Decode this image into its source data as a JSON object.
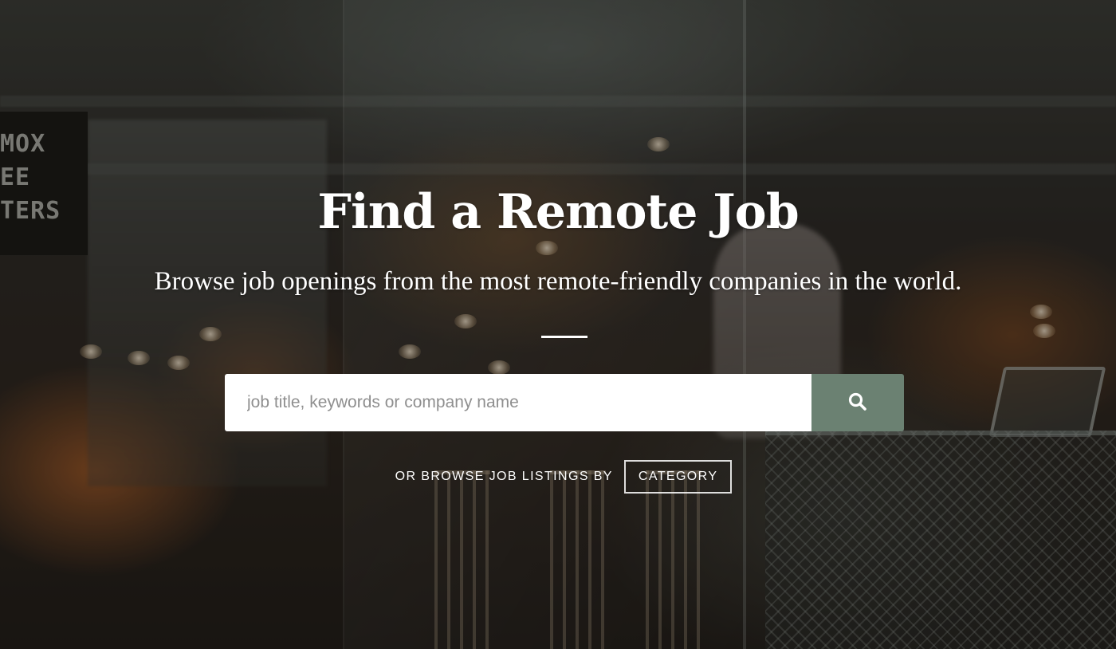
{
  "hero": {
    "title": "Find a Remote Job",
    "subtitle": "Browse job openings from the most remote-friendly companies in the world."
  },
  "search": {
    "placeholder": "job title, keywords or company name",
    "value": "",
    "button_icon": "search-icon"
  },
  "browse": {
    "label": "OR BROWSE JOB LISTINGS BY",
    "category_button": "CATEGORY"
  },
  "background": {
    "sign_lines": [
      "MOX",
      "EE",
      "TERS"
    ]
  },
  "colors": {
    "search_button": "#6b8172",
    "text": "#ffffff",
    "input_background": "#ffffff"
  }
}
